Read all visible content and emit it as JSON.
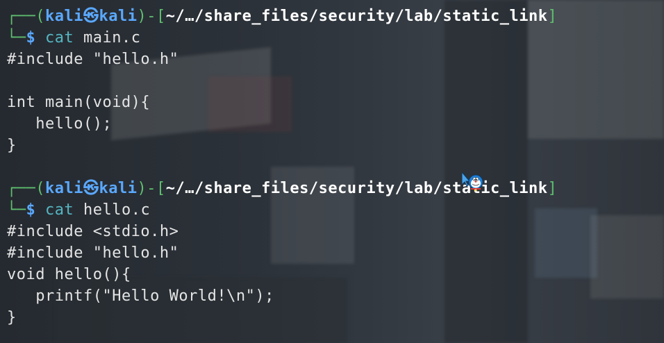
{
  "terminal": {
    "blocks": [
      {
        "prompt": {
          "frame_top": "┌──(",
          "user": "kali",
          "at_symbol": "㉿",
          "host": "kali",
          "mid": ")-[",
          "path": "~/…/share_files/security/lab/static_link",
          "close": "]",
          "frame_bottom": "└─",
          "dollar": "$",
          "command": "cat",
          "argument": "main.c"
        },
        "output": [
          "#include \"hello.h\"",
          "",
          "int main(void){",
          "   hello();",
          "}",
          ""
        ]
      },
      {
        "prompt": {
          "frame_top": "┌──(",
          "user": "kali",
          "at_symbol": "㉿",
          "host": "kali",
          "mid": ")-[",
          "path": "~/…/share_files/security/lab/static_link",
          "close": "]",
          "frame_bottom": "└─",
          "dollar": "$",
          "command": "cat",
          "argument": "hello.c"
        },
        "output": [
          "#include <stdio.h>",
          "#include \"hello.h\"",
          "void hello(){",
          "   printf(\"Hello World!\\n\");",
          "}"
        ]
      }
    ]
  },
  "colors": {
    "frame": "#5fbf6f",
    "user_host": "#5aa8ff",
    "path": "#ffffff",
    "command": "#55b6c2",
    "text": "#e4e4e4"
  },
  "mouse_cursor": {
    "icon": "doraemon-cursor-icon"
  }
}
